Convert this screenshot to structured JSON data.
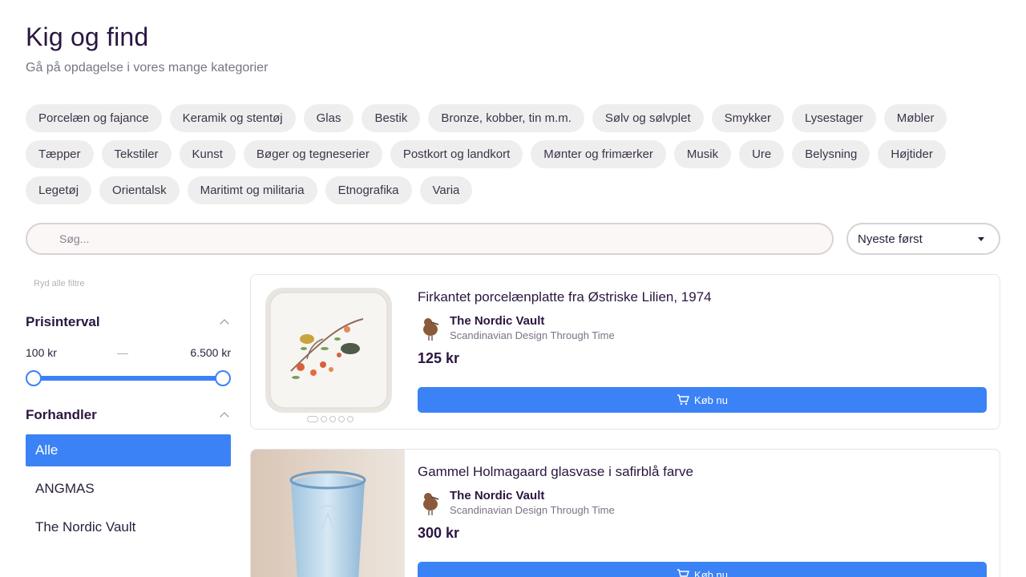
{
  "header": {
    "title": "Kig og find",
    "subtitle": "Gå på opdagelse i vores mange kategorier"
  },
  "categories": [
    "Porcelæn og fajance",
    "Keramik og stentøj",
    "Glas",
    "Bestik",
    "Bronze, kobber, tin m.m.",
    "Sølv og sølvplet",
    "Smykker",
    "Lysestager",
    "Møbler",
    "Tæpper",
    "Tekstiler",
    "Kunst",
    "Bøger og tegneserier",
    "Postkort og landkort",
    "Mønter og frimærker",
    "Musik",
    "Ure",
    "Belysning",
    "Højtider",
    "Legetøj",
    "Orientalsk",
    "Maritimt og militaria",
    "Etnografika",
    "Varia"
  ],
  "search": {
    "placeholder": "Søg...",
    "value": ""
  },
  "sort": {
    "selected": "Nyeste først"
  },
  "filters": {
    "clear_label": "Ryd alle filtre",
    "price": {
      "heading": "Prisinterval",
      "min_label": "100 kr",
      "separator": "—",
      "max_label": "6.500 kr",
      "range_min": 100,
      "range_max": 6500,
      "selected_min": 100,
      "selected_max": 6500
    },
    "dealer": {
      "heading": "Forhandler",
      "items": [
        "Alle",
        "ANGMAS",
        "The Nordic Vault"
      ],
      "active_index": 0
    }
  },
  "products": [
    {
      "title": "Firkantet porcelænplatte fra Østriske Lilien, 1974",
      "dealer_name": "The Nordic Vault",
      "dealer_tagline": "Scandinavian Design Through Time",
      "price": "125 kr",
      "buy_label": "Køb nu",
      "image_count": 5,
      "active_image": 0
    },
    {
      "title": "Gammel Holmagaard glasvase i safirblå farve",
      "dealer_name": "The Nordic Vault",
      "dealer_tagline": "Scandinavian Design Through Time",
      "price": "300 kr",
      "buy_label": "Køb nu"
    }
  ],
  "colors": {
    "accent": "#3b82f6",
    "chip_bg": "#efeeef",
    "heading": "#2a1640"
  }
}
